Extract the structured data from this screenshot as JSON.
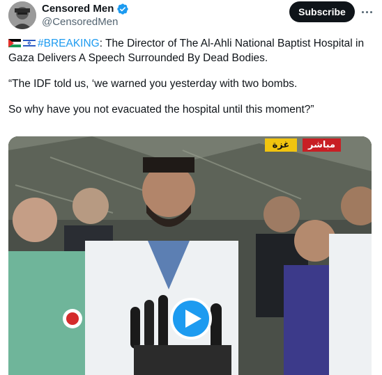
{
  "author": {
    "display_name": "Censored Men",
    "handle": "@CensoredMen",
    "avatar_icon": "avatar-photo",
    "verified_icon": "verified-badge-icon"
  },
  "actions": {
    "subscribe_label": "Subscribe",
    "more_icon": "more-options-icon"
  },
  "post": {
    "flags": [
      "palestine-flag-icon",
      "israel-flag-icon"
    ],
    "hashtag": "#BREAKING",
    "headline_rest": ": The Director of The Al-Ahli National Baptist Hospital in Gaza Delivers A Speech Surrounded By Dead Bodies.",
    "quote_line_1": "“The IDF told us, ‘we warned you yesterday with two bombs.",
    "quote_line_2": "So why have you not evacuated the hospital until this moment?”"
  },
  "media": {
    "live_badge": "مباشر",
    "place_badge": "غزة",
    "play_icon": "play-icon",
    "accent_color": "#1d9bf0"
  }
}
